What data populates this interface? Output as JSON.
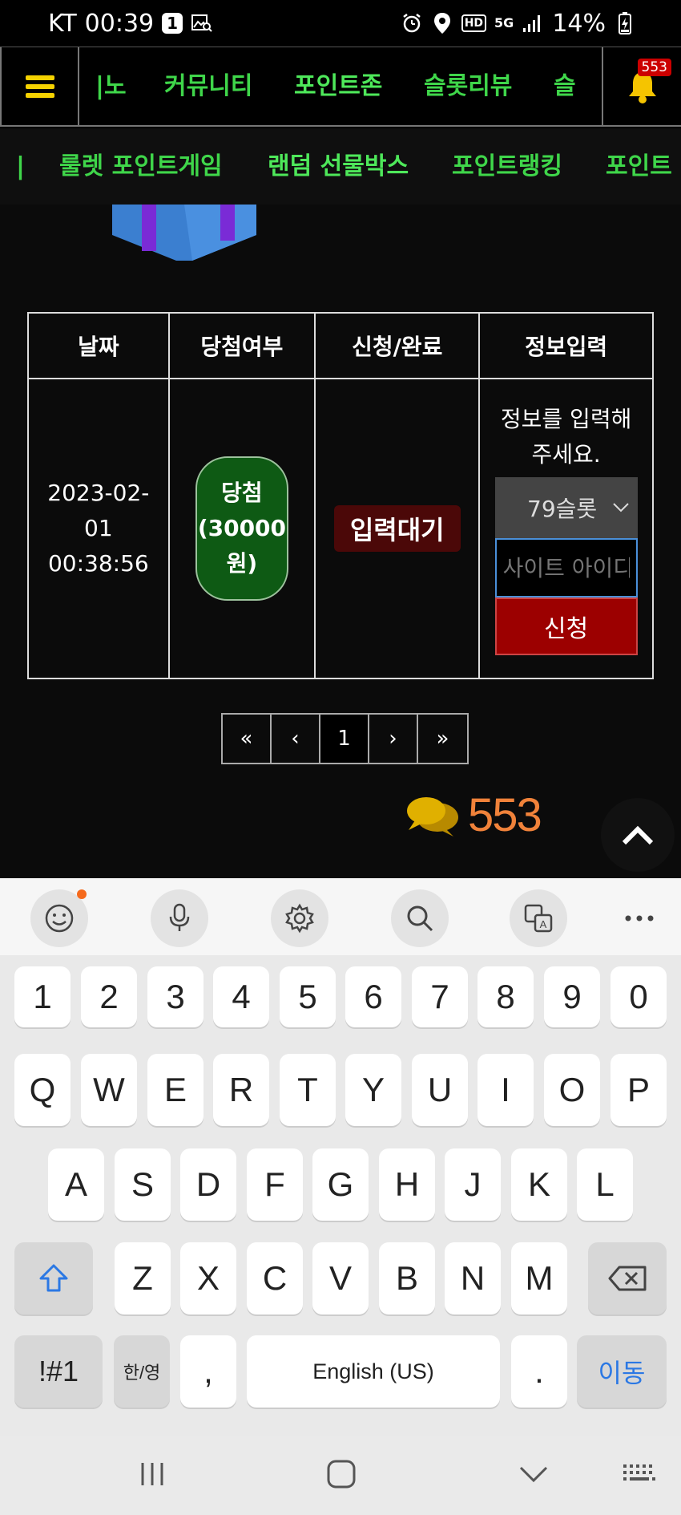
{
  "status_bar": {
    "carrier": "KT",
    "time": "00:39",
    "notif_count": "1",
    "battery": "14%",
    "hd_label": "HD",
    "net_label": "5G"
  },
  "top_nav": {
    "items": [
      "|노",
      "커뮤니티",
      "포인트존",
      "슬롯리뷰",
      "슬"
    ],
    "active": "포인트존",
    "bell_count": "553"
  },
  "sub_nav": {
    "items": [
      "|",
      "룰렛 포인트게임",
      "랜덤 선물박스",
      "포인트랭킹",
      "포인트"
    ],
    "active": "랜덤 선물박스"
  },
  "table": {
    "headers": [
      "날짜",
      "당첨여부",
      "신청/완료",
      "정보입력"
    ],
    "row": {
      "date": "2023-02-\n01\n00:38:56",
      "result": "당첨\n(30000\n원)",
      "status": "입력대기",
      "info_prompt": "정보를 입력해\n주세요.",
      "site_select": "79슬롯",
      "id_placeholder": "사이트 아이디",
      "apply_label": "신청"
    }
  },
  "pagination": [
    "«",
    "‹",
    "1",
    "›",
    "»"
  ],
  "chat": {
    "count": "553"
  },
  "keyboard": {
    "numbers": [
      "1",
      "2",
      "3",
      "4",
      "5",
      "6",
      "7",
      "8",
      "9",
      "0"
    ],
    "row1": [
      "Q",
      "W",
      "E",
      "R",
      "T",
      "Y",
      "U",
      "I",
      "O",
      "P"
    ],
    "row2": [
      "A",
      "S",
      "D",
      "F",
      "G",
      "H",
      "J",
      "K",
      "L"
    ],
    "row3": [
      "Z",
      "X",
      "C",
      "V",
      "B",
      "N",
      "M"
    ],
    "sym_label": "!#1",
    "lang_toggle": "한/영",
    "comma": ",",
    "space_label": "English (US)",
    "period": ".",
    "enter_label": "이동"
  },
  "colors": {
    "nav_green": "#3fd64a",
    "bell_yellow": "#f5d200",
    "win_green": "#0e5a14",
    "apply_red": "#9c0000",
    "chat_orange": "#f0823a",
    "key_blue": "#2b78e4"
  }
}
